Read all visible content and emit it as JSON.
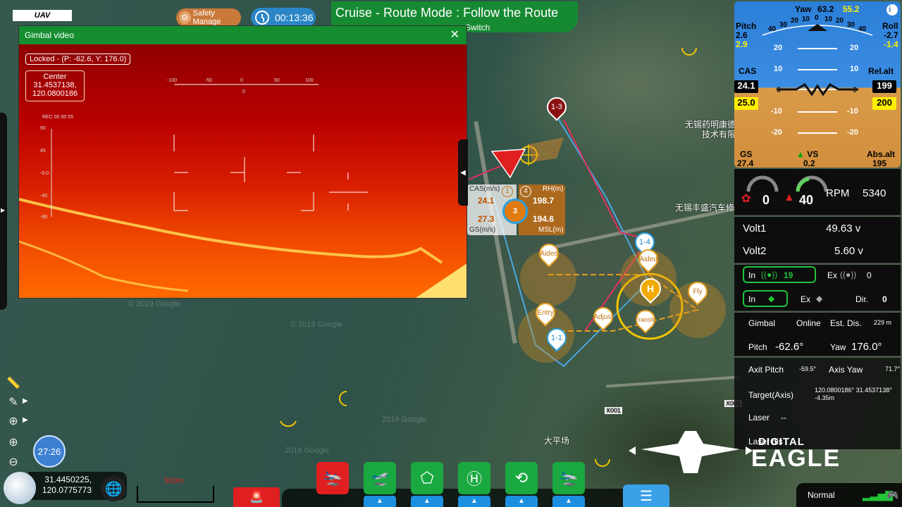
{
  "app": {
    "tag": "UAV"
  },
  "topbar": {
    "safety_label": "Safety Manage",
    "timer": "00:13:36",
    "mode_title": "Cruise - Route Mode : Follow the Route",
    "mode_sub": "Switch"
  },
  "gimbal": {
    "title": "Gimbal video",
    "close": "✕",
    "locked": "Locked - (P: -62.6, Y: 176.0)",
    "center_label": "Center",
    "center_lat": "31.4537138,",
    "center_lon": "120.0800186",
    "scale_ticks": [
      "-100",
      "-50",
      "0",
      "50",
      "100"
    ],
    "scale_zero": "0",
    "rec": "REC 00 00 55",
    "side_ticks": [
      "90",
      "45",
      "-0.0",
      "-45",
      "-90"
    ]
  },
  "map": {
    "labels": [
      "无锡药明康德",
      "技术有限公司",
      "无锡丰盛汽车修",
      "大平场",
      "X001",
      "X001"
    ],
    "watermarks": [
      "© 2019 Google",
      "© 2019 Google",
      "2019 Google",
      "2019 Google"
    ],
    "markers": {
      "m13": "1-3",
      "m14": "1-4",
      "m11": "1-1",
      "aided1": "Aided",
      "aided2": "Aided",
      "entry": "Entry",
      "adjust": "Adjust",
      "transfer": "Transfe",
      "fly": "Fly",
      "home": "H"
    },
    "flight_data": {
      "cas_label": "CAS(m/s)",
      "cas": "24.1",
      "gs": "27.3",
      "gs_label": "GS(m/s)",
      "rh_label": "RH(m)",
      "rh": "198.7",
      "msl": "194.6",
      "msl_label": "MSL(m)",
      "wp_a": "1",
      "wp_b": "4",
      "wp_c": "3"
    }
  },
  "left_tools": {
    "clock": "27:26",
    "lat": "31.4450225,",
    "lon": "120.0775773",
    "scale": "500m"
  },
  "right_panel": {
    "pfd": {
      "yaw_label": "Yaw",
      "yaw": "63.2",
      "yaw_target": "55.2",
      "pitch_label": "Pitch",
      "pitch": "2.6",
      "pitch_target": "2.9",
      "roll_label": "Roll",
      "roll": "-2.7",
      "roll_target": "-1.4",
      "heading_ticks": [
        "40",
        "30",
        "20",
        "10",
        "0",
        "10",
        "20",
        "30",
        "40"
      ],
      "ladder": [
        "20",
        "10",
        "0",
        "-10",
        "-20"
      ],
      "cas_label": "CAS",
      "cas": "24.1",
      "cas_target": "25.0",
      "relalt_label": "Rel.alt",
      "relalt": "199",
      "relalt_target": "200",
      "gs_label": "GS",
      "gs": "27.4",
      "vs_label": "VS",
      "vs": "0.2",
      "absalt_label": "Abs.alt",
      "absalt": "195"
    },
    "engine": {
      "left_val": "0",
      "right_val": "40",
      "rpm_label": "RPM",
      "rpm": "5340"
    },
    "volt": {
      "v1_label": "Volt1",
      "v1": "49.63 v",
      "v2_label": "Volt2",
      "v2": "5.60 v"
    },
    "link": {
      "in_label": "In",
      "in_val": "19",
      "ex_label": "Ex",
      "ex_val": "0",
      "in2_label": "In",
      "ex2_label": "Ex",
      "dir_label": "Dir.",
      "dir_val": "0"
    },
    "gimbal_status": {
      "gimbal_label": "Gimbal",
      "online": "Online",
      "est_label": "Est. Dis.",
      "est_val": "229 m",
      "pitch_label": "Pitch",
      "pitch": "-62.6°",
      "yaw_label": "Yaw",
      "yaw": "176.0°",
      "axit_pitch_label": "Axit Pitch",
      "axit_pitch": "-59.5°",
      "axis_yaw_label": "Axis Yaw",
      "axis_yaw": "71.7°",
      "target_label": "Target(Axis)",
      "target_val": "120.0800186° 31.4537138°",
      "target_alt": "-4.35m",
      "laser_label": "Laser",
      "laser_val": "--",
      "laser_dis_label": "Laser dis"
    }
  },
  "brand": {
    "line1": "DIGITAL",
    "line2": "EAGLE"
  },
  "status": {
    "mode": "Normal"
  },
  "colors": {
    "accent_green": "#168a33",
    "accent_blue": "#2a86c6",
    "alarm_red": "#e02020",
    "route_orange": "#e8a020"
  }
}
